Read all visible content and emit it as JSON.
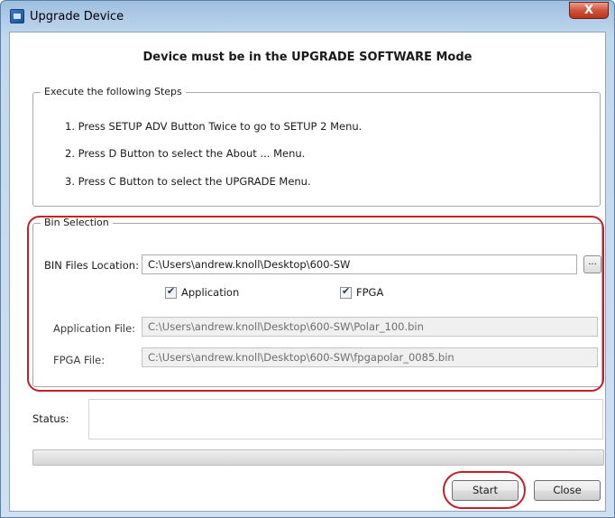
{
  "window": {
    "title": "Upgrade Device",
    "close_glyph": "X"
  },
  "header": "Device must be in the UPGRADE SOFTWARE Mode",
  "steps": {
    "legend": "Execute the following Steps",
    "items": [
      "1.  Press SETUP ADV Button Twice to go to SETUP 2 Menu.",
      "2.  Press D Button to select the About ... Menu.",
      "3.  Press C Button to select the UPGRADE Menu."
    ]
  },
  "bin": {
    "legend": "Bin Selection",
    "location_label": "BIN Files Location:",
    "location_value": "C:\\Users\\andrew.knoll\\Desktop\\600-SW",
    "browse_label": "...",
    "application_checkbox": {
      "label": "Application",
      "checked": true
    },
    "fpga_checkbox": {
      "label": "FPGA",
      "checked": true
    },
    "application_file_label": "Application File:",
    "application_file_value": "C:\\Users\\andrew.knoll\\Desktop\\600-SW\\Polar_100.bin",
    "fpga_file_label": "FPGA File:",
    "fpga_file_value": "C:\\Users\\andrew.knoll\\Desktop\\600-SW\\fpgapolar_0085.bin"
  },
  "status": {
    "label": "Status:",
    "value": ""
  },
  "progress": {
    "value": 0
  },
  "buttons": {
    "start": "Start",
    "close": "Close"
  },
  "colors": {
    "highlight": "#c4202a",
    "title_bar": "#c2d8ee"
  }
}
